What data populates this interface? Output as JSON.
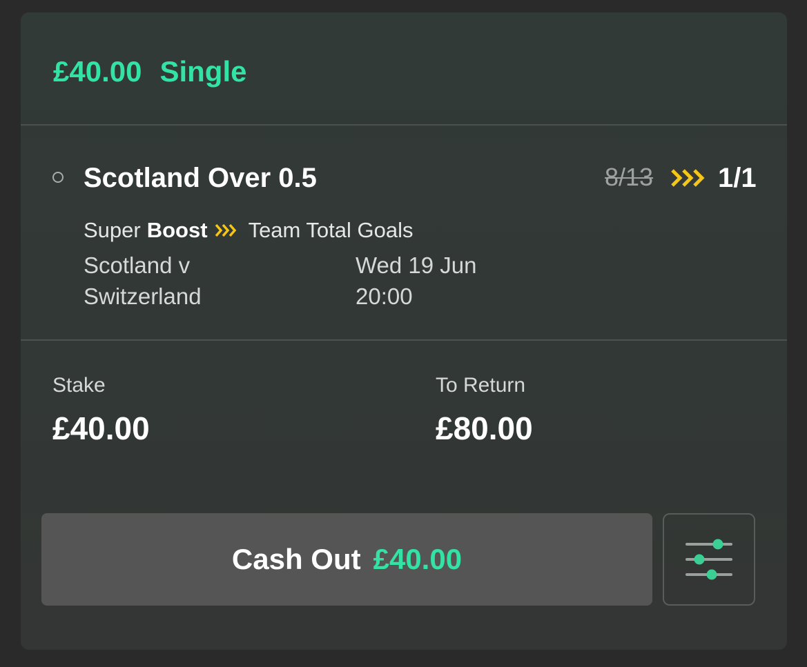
{
  "bet": {
    "stake_amount": "£40.00",
    "type": "Single"
  },
  "selection": {
    "name": "Scotland Over 0.5",
    "old_odds": "8/13",
    "new_odds": "1/1",
    "boost_prefix": "Super",
    "boost_bold": "Boost",
    "market": "Team Total Goals",
    "event_line1": "Scotland v",
    "event_line2": "Switzerland",
    "date": "Wed 19 Jun",
    "time": "20:00",
    "boost_icon": "boost-chevrons-icon",
    "status_icon": "open-status-circle-icon"
  },
  "summary": {
    "stake_label": "Stake",
    "stake_value": "£40.00",
    "return_label": "To Return",
    "return_value": "£80.00"
  },
  "actions": {
    "cashout_label": "Cash Out",
    "cashout_amount": "£40.00",
    "settings_icon": "sliders-icon"
  },
  "colors": {
    "accent_green": "#33e2a5",
    "boost_yellow": "#f5c518",
    "card_bg": "#313a37",
    "button_bg": "#545554"
  }
}
